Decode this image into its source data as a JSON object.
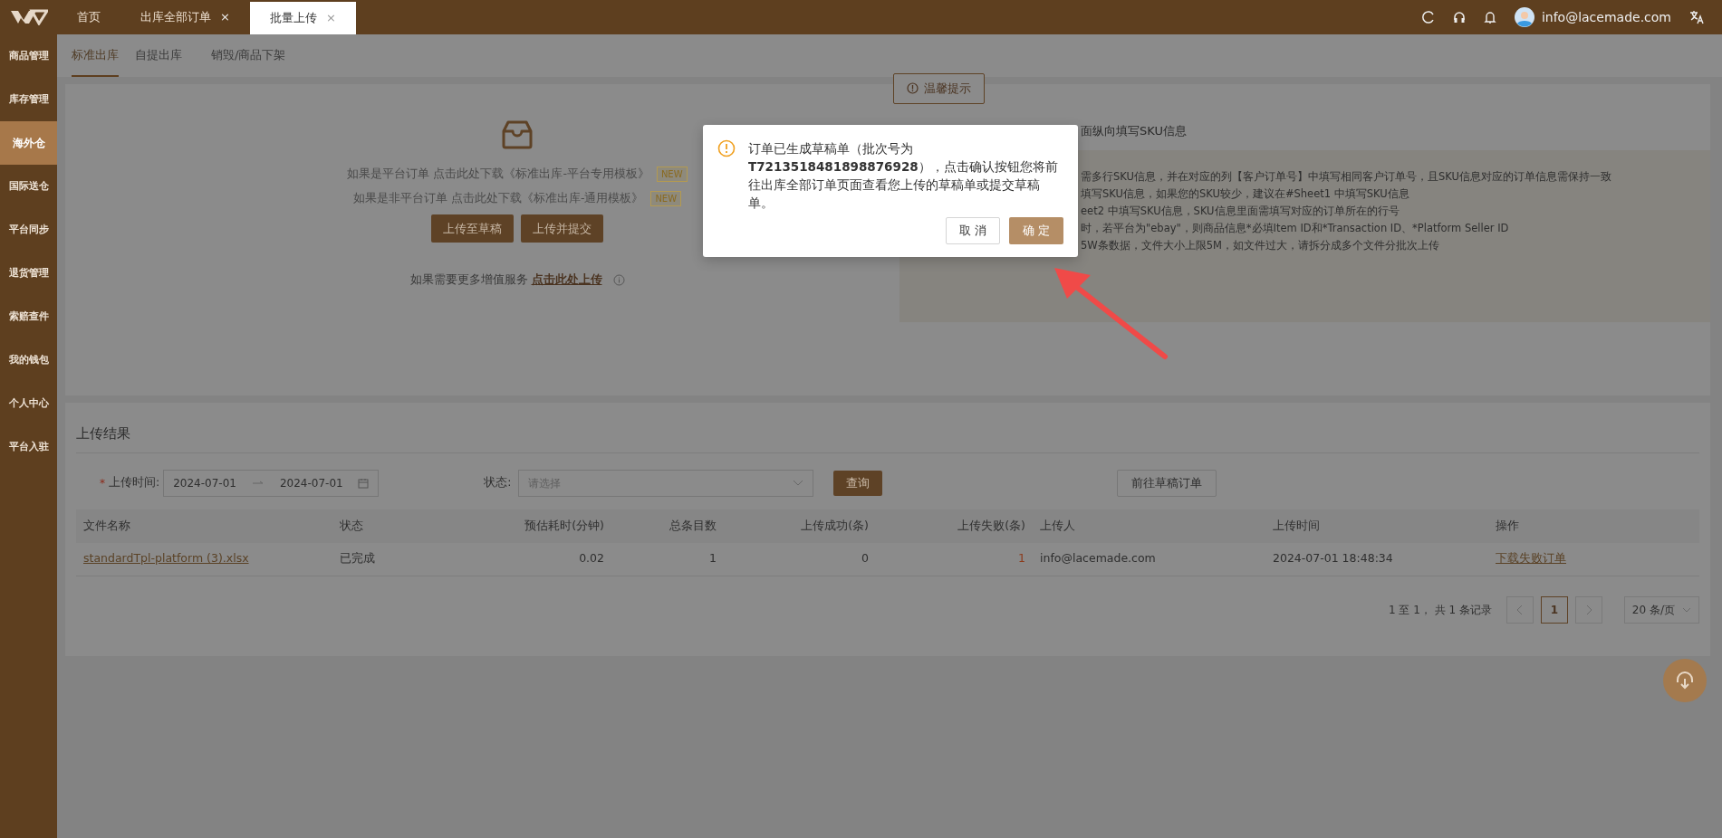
{
  "top_bar": {
    "tabs": [
      {
        "label": "首页",
        "selected": false
      },
      {
        "label": "出库全部订单",
        "close": "×",
        "selected": false
      },
      {
        "label": "批量上传",
        "close": "×",
        "selected": true
      }
    ],
    "user": "info@lacemade.com"
  },
  "sidebar": {
    "items": [
      {
        "label": "商品管理",
        "selected": false
      },
      {
        "label": "库存管理",
        "selected": false
      },
      {
        "label": "海外仓",
        "selected": true
      },
      {
        "label": "国际送仓",
        "selected": false
      },
      {
        "label": "平台同步",
        "selected": false
      },
      {
        "label": "退货管理",
        "selected": false
      },
      {
        "label": "索赔查件",
        "selected": false
      },
      {
        "label": "我的钱包",
        "selected": false
      },
      {
        "label": "个人中心",
        "selected": false
      },
      {
        "label": "平台入驻",
        "selected": false
      }
    ]
  },
  "sub_tabs": [
    {
      "label": "标准出库",
      "selected": true
    },
    {
      "label": "自提出库",
      "selected": false
    },
    {
      "label": "销毁/商品下架",
      "selected": false
    }
  ],
  "upload": {
    "lines": [
      {
        "text": "如果是平台订单 点击此处下载《标准出库-平台专用模板》",
        "badge": "NEW"
      },
      {
        "text": "如果是非平台订单 点击此处下载《标准出库-通用模板》",
        "badge": "NEW"
      }
    ],
    "buttons": [
      "上传至草稿",
      "上传并提交"
    ],
    "service_text": "如果需要更多增值服务",
    "service_link": "点击此处上传"
  },
  "hint": {
    "button": "温馨提示",
    "title": "面纵向填写SKU信息",
    "lines": [
      "需多行SKU信息，并在对应的列【客户订单号】中填写相同客户订单号，且SKU信息对应的订单信息需保持一致",
      "填写SKU信息，如果您的SKU较少，建议在#Sheet1 中填写SKU信息",
      "eet2 中填写SKU信息，SKU信息里面需填写对应的订单所在的行号",
      "时，若平台为\"ebay\"，则商品信息*必填Item ID和*Transaction ID、*Platform Seller ID",
      "5W条数据，文件大小上限5M，如文件过大，请拆分成多个文件分批次上传"
    ]
  },
  "results": {
    "title": "上传结果",
    "required_mark": "*",
    "date_label": "上传时间:",
    "date_from": "2024-07-01",
    "date_to": "2024-07-01",
    "status_label": "状态:",
    "status_placeholder": "请选择",
    "query_button": "查询",
    "draft_button": "前往草稿订单",
    "columns": [
      {
        "label": "文件名称",
        "kind": "text"
      },
      {
        "label": "状态",
        "kind": "text"
      },
      {
        "label": "预估耗时(分钟)",
        "kind": "number"
      },
      {
        "label": "总条目数",
        "kind": "number"
      },
      {
        "label": "上传成功(条)",
        "kind": "number"
      },
      {
        "label": "上传失败(条)",
        "kind": "number"
      },
      {
        "label": "上传人",
        "kind": "text"
      },
      {
        "label": "上传时间",
        "kind": "text"
      },
      {
        "label": "操作",
        "kind": "text"
      }
    ],
    "rows": [
      {
        "cells": [
          {
            "text": "standardTpl-platform (3).xlsx",
            "kind": "link"
          },
          {
            "text": "已完成",
            "kind": "text"
          },
          {
            "text": "0.02",
            "kind": "text"
          },
          {
            "text": "1",
            "kind": "text"
          },
          {
            "text": "0",
            "kind": "text"
          },
          {
            "text": "1",
            "kind": "error"
          },
          {
            "text": "info@lacemade.com",
            "kind": "text"
          },
          {
            "text": "2024-07-01 18:48:34",
            "kind": "text"
          },
          {
            "text": "下载失败订单",
            "kind": "link"
          }
        ]
      }
    ],
    "pagination": {
      "summary": "1 至 1， 共 1 条记录",
      "pages": [
        {
          "label": "1",
          "selected": true
        }
      ],
      "page_size": "20 条/页"
    }
  },
  "dialog": {
    "message": "订单已生成草稿单（批次号为 **T7213518481898876928**），点击确认按钮您将前往出库全部订单页面查看您上传的草稿单或提交草稿单。",
    "cancel": "取 消",
    "confirm": "确 定"
  }
}
